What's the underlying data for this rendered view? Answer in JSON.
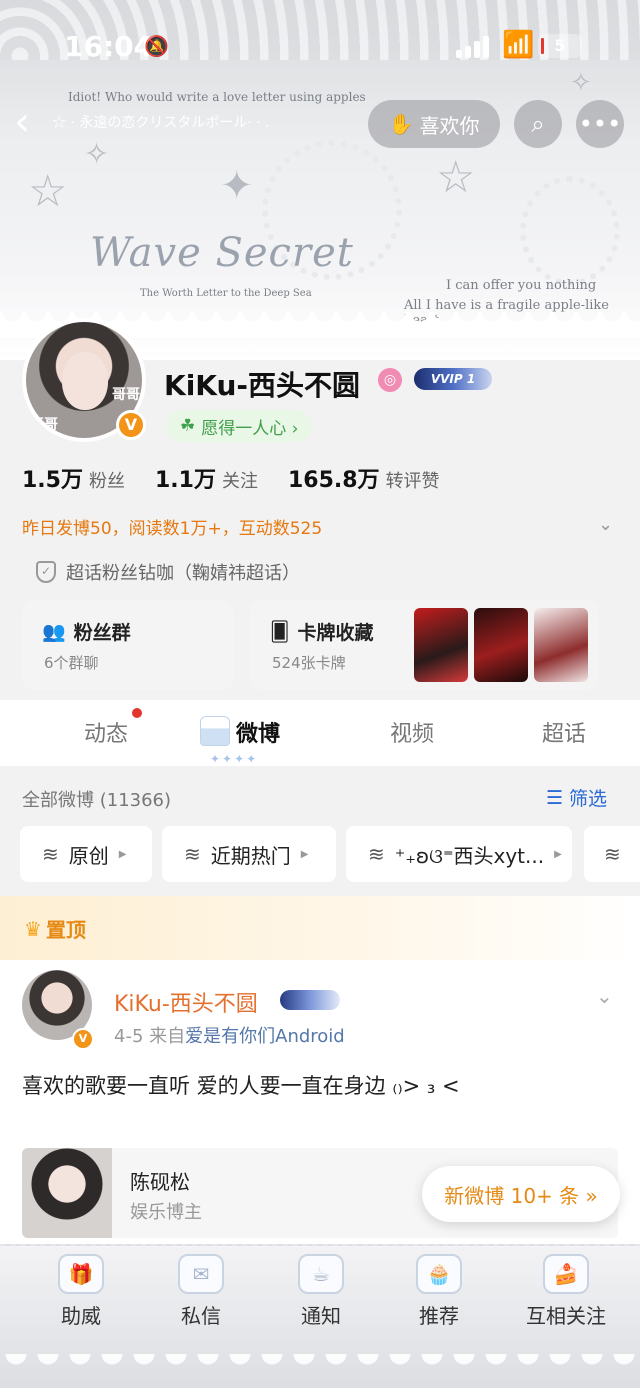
{
  "status_bar": {
    "time": "16:04",
    "battery": "5"
  },
  "banner": {
    "line1": "Idiot! Who would write a love letter using apples",
    "line2": "☆ · 永遠の恋クリスタルボール· · .",
    "title": "Wave Secret",
    "subtitle": "The Worth Letter to the Deep Sea",
    "line3": "I can offer you nothing",
    "line4": "All I have is a fragile apple-like heart"
  },
  "nav": {
    "back": "‹",
    "like_label": "喜欢你"
  },
  "profile": {
    "avatar_text_left": "哥哥",
    "avatar_text_right": "哥哥",
    "nickname": "KiKu-西头不圆",
    "vip_label": "VVIP 1",
    "wish": "愿得一人心 ›",
    "stats": [
      {
        "num": "1.5万",
        "label": "粉丝"
      },
      {
        "num": "1.1万",
        "label": "关注"
      },
      {
        "num": "165.8万",
        "label": "转评赞"
      }
    ],
    "summary": "昨日发博50，阅读数1万+，互动数525",
    "super_topic": "超话粉丝钻咖（鞠婧祎超话）"
  },
  "cards": {
    "fans": {
      "title": "粉丝群",
      "sub": "6个群聊"
    },
    "collect": {
      "title": "卡牌收藏",
      "sub": "524张卡牌"
    }
  },
  "tabs": [
    "动态",
    "微博",
    "视频",
    "超话"
  ],
  "feed": {
    "count": "全部微博 (11366)",
    "filter": "筛选",
    "chips": [
      "原创",
      "近期热门",
      "⁺₊ʚଓ⁼西头xyt..."
    ]
  },
  "post": {
    "pinned_label": "置顶",
    "author": "KiKu-西头不圆",
    "date": "4-5",
    "source_prefix": "来自",
    "source": "爱是有你们Android",
    "text": "喜欢的歌要一直听 爱的人要一直在身边 ₍₎> ₃ <",
    "ref_name": "陈砚松",
    "ref_sub": "娱乐博主",
    "new_pill": "新微博 10+ 条 »"
  },
  "bottom_tabs": [
    "助威",
    "私信",
    "通知",
    "推荐",
    "互相关注"
  ],
  "colors": {
    "accent_orange": "#e58a15",
    "link_blue": "#2b6bd6",
    "author_orange": "#e4702e"
  }
}
